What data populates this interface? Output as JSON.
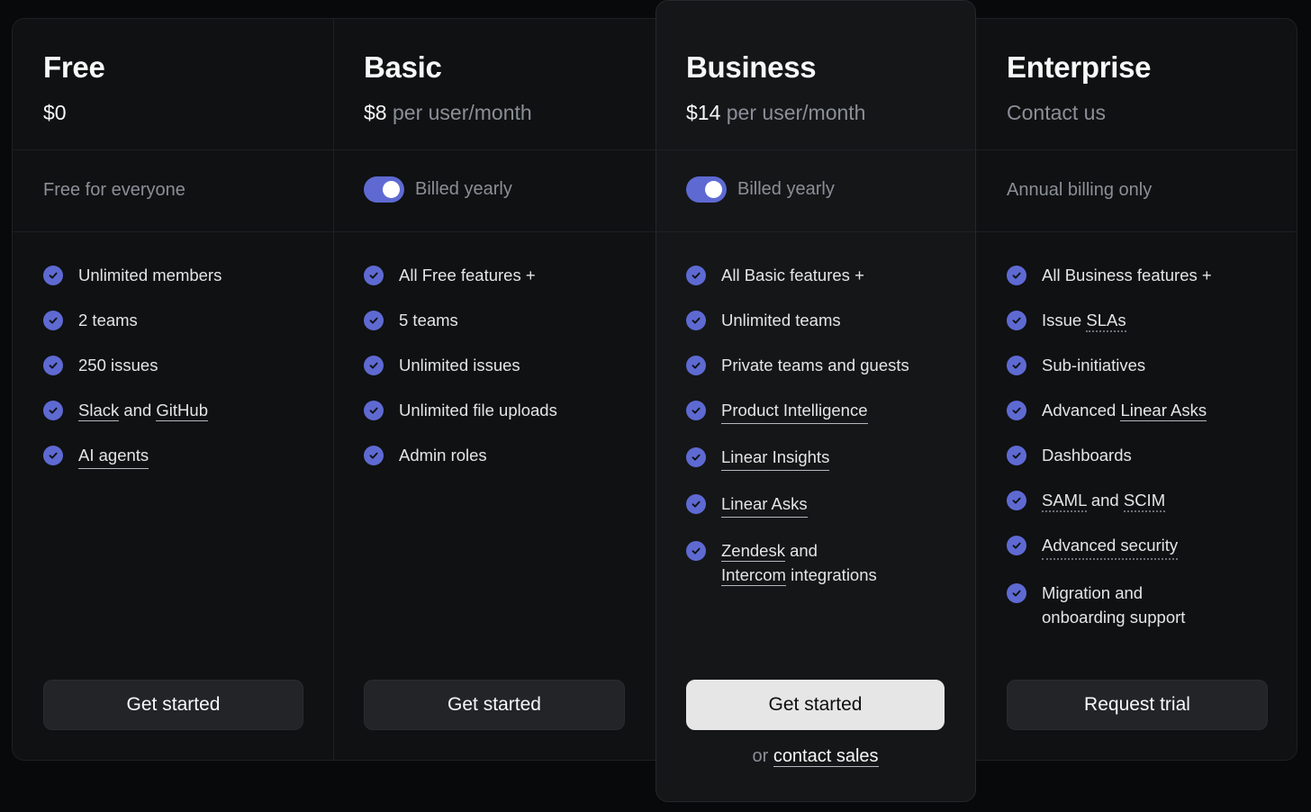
{
  "colors": {
    "accent": "#5e6ad2",
    "background": "#08090a",
    "panel": "#101112",
    "text_muted": "#8a8f98"
  },
  "plans": [
    {
      "name": "Free",
      "price_amount": "$0",
      "billing_text": "Free for everyone",
      "features": [
        "Unlimited members",
        "2 teams",
        "250 issues"
      ],
      "feature_slack": "Slack",
      "feature_and": "and",
      "feature_github": "GitHub",
      "feature_ai": "AI agents",
      "cta": "Get started"
    },
    {
      "name": "Basic",
      "price_amount": "$8",
      "price_unit": "per user/month",
      "billing_toggle_label": "Billed yearly",
      "billing_toggle_on": true,
      "features": [
        "All Free features +",
        "5 teams",
        "Unlimited issues",
        "Unlimited file uploads",
        "Admin roles"
      ],
      "cta": "Get started"
    },
    {
      "name": "Business",
      "price_amount": "$14",
      "price_unit": "per user/month",
      "billing_toggle_label": "Billed yearly",
      "billing_toggle_on": true,
      "features": [
        "All Basic features +",
        "Unlimited teams",
        "Private teams and guests",
        "Product Intelligence",
        "Linear Insights",
        "Linear Asks"
      ],
      "feature_zendesk": "Zendesk",
      "feature_and": "and",
      "feature_intercom": "Intercom",
      "feature_integrations": "integrations",
      "cta": "Get started",
      "contact_prefix": "or",
      "contact_link": "contact sales"
    },
    {
      "name": "Enterprise",
      "price_text": "Contact us",
      "billing_text": "Annual billing only",
      "features": [
        "All Business features +",
        "Sub-initiatives",
        "Dashboards",
        "Advanced security",
        "Migration and onboarding support"
      ],
      "feature_issue": "Issue",
      "feature_slas": "SLAs",
      "feature_advanced": "Advanced",
      "feature_linear_asks": "Linear Asks",
      "feature_saml": "SAML",
      "feature_and": "and",
      "feature_scim": "SCIM",
      "cta": "Request trial"
    }
  ]
}
